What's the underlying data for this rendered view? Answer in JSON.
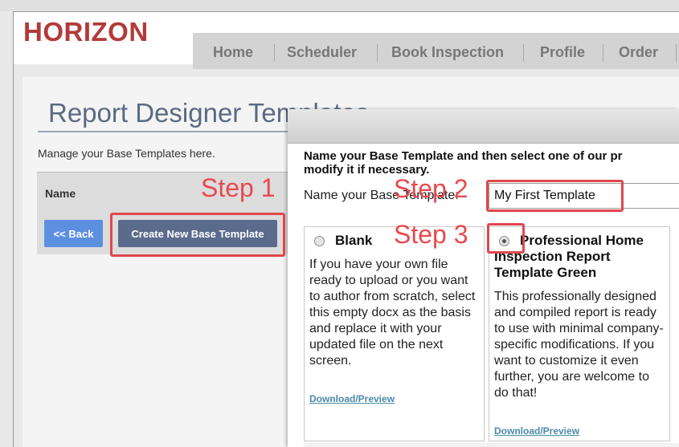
{
  "brand": {
    "logo_text": "HORIZON",
    "logo_color": "#b33a3a"
  },
  "nav": {
    "items": [
      {
        "label": "Home"
      },
      {
        "label": "Scheduler"
      },
      {
        "label": "Book Inspection"
      },
      {
        "label": "Profile"
      },
      {
        "label": "Order"
      }
    ]
  },
  "page": {
    "title": "Report Designer Templates",
    "subtitle": "Manage your Base Templates here.",
    "table_header": "Name",
    "back_label": "<< Back",
    "create_label": "Create New Base Template"
  },
  "dialog": {
    "instruction_line1": "Name your Base Template and then select one of our pr",
    "instruction_line2": "modify it if necessary.",
    "name_label": "Name your Base Template:",
    "name_value": "My First Template",
    "options": [
      {
        "title": "Blank",
        "description": "If you have your own file ready to upload or you want to author from scratch, select this empty docx as the basis and replace it with your updated file on the next screen.",
        "link": "Download/Preview",
        "selected": false
      },
      {
        "title": "Professional Home Inspection Report Template Green",
        "description": "This professionally designed and compiled report is ready to use with minimal company-specific modifications. If you want to customize it even further, you are welcome to do that!",
        "link": "Download/Preview",
        "selected": true
      }
    ]
  },
  "annotations": {
    "step1": "Step 1",
    "step2": "Step 2",
    "step3": "Step 3",
    "highlight_color": "#e0474c"
  },
  "colors": {
    "accent_blue": "#5d8fe0",
    "button_slate": "#5a6b8c",
    "link": "#4a8aa8"
  }
}
